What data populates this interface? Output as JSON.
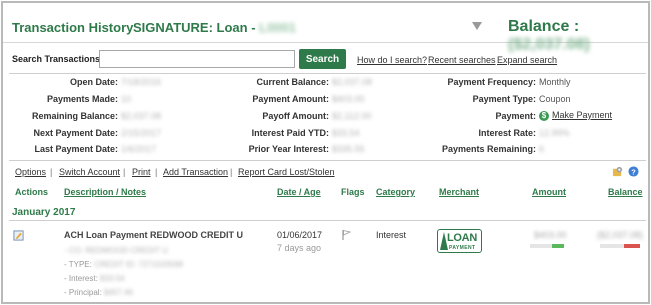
{
  "header": {
    "title": "Transaction History",
    "account_label": "SIGNATURE: Loan - ",
    "account_number": "L0001",
    "balance_label": "Balance : ",
    "balance_value": "($2,037.08)"
  },
  "search": {
    "label": "Search Transactions:",
    "placeholder": "",
    "button": "Search",
    "links": [
      "How do I search?",
      "Recent searches",
      "Expand search"
    ]
  },
  "summary": {
    "col1": [
      {
        "label": "Open Date:",
        "value": "7/18/2016"
      },
      {
        "label": "Payments Made:",
        "value": "10"
      },
      {
        "label": "Remaining Balance:",
        "value": "$2,037.08"
      },
      {
        "label": "Next Payment Date:",
        "value": "2/15/2017"
      },
      {
        "label": "Last Payment Date:",
        "value": "1/6/2017"
      }
    ],
    "col2": [
      {
        "label": "Current Balance:",
        "value": "$2,037.08"
      },
      {
        "label": "Payment Amount:",
        "value": "$403.00"
      },
      {
        "label": "Payoff Amount:",
        "value": "$2,112.00"
      },
      {
        "label": "Interest Paid YTD:",
        "value": "$33.54"
      },
      {
        "label": "Prior Year Interest:",
        "value": "$335.55"
      }
    ],
    "col3": [
      {
        "label": "Payment Frequency:",
        "value": "Monthly"
      },
      {
        "label": "Payment Type:",
        "value": "Coupon"
      },
      {
        "label": "Payment:",
        "value": "Make Payment"
      },
      {
        "label": "Interest Rate:",
        "value": "12.99%"
      },
      {
        "label": "Payments Remaining:",
        "value": "6"
      }
    ]
  },
  "options": [
    "Options",
    "Switch Account",
    "Print",
    "Add Transaction",
    "Report Card Lost/Stolen"
  ],
  "columns": {
    "actions": "Actions",
    "description": "Description / Notes",
    "date": "Date / Age",
    "flags": "Flags",
    "category": "Category",
    "merchant": "Merchant",
    "amount": "Amount",
    "balance": "Balance"
  },
  "month": "January 2017",
  "transaction": {
    "description": "ACH Loan Payment REDWOOD CREDIT U",
    "note1": "- CO: REDWOOD CREDIT U",
    "note2_label": "- TYPE: ",
    "note2_value": "CREDIT ID: 7271533598",
    "note3_label": "- Interest: ",
    "note3_value": "$33.54",
    "note4_label": "- Principal: ",
    "note4_value": "$457.46",
    "date": "01/06/2017",
    "age": "7 days ago",
    "category": "Interest",
    "merchant_big": "LOAN",
    "merchant_small": "PAYMENT",
    "amount": "$403.00",
    "balance": "($2,037.08)"
  },
  "colors": {
    "accent": "#2f7a4a",
    "positive_bar": "#5cb85c",
    "negative_bar": "#d9534f"
  }
}
